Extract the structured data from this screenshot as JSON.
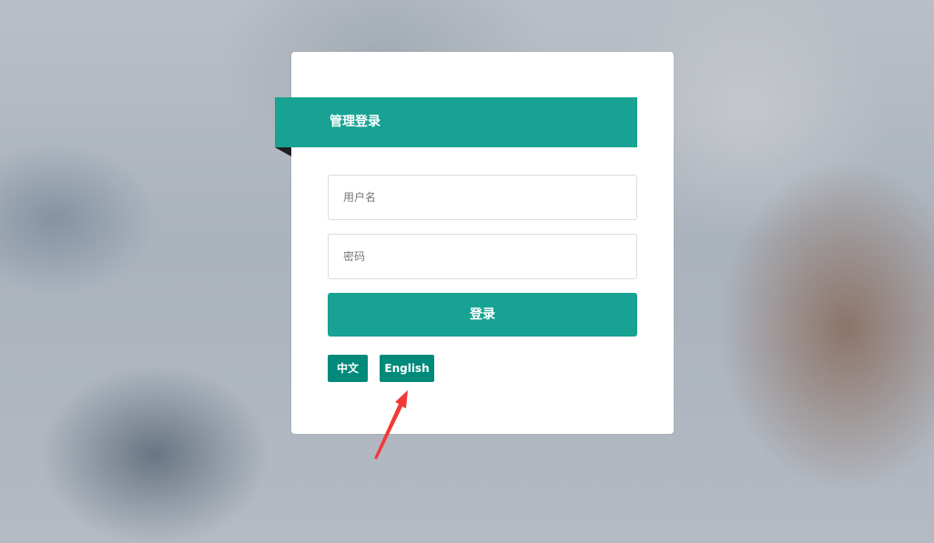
{
  "login_panel": {
    "title": "管理登录",
    "username_placeholder": "用户名",
    "password_placeholder": "密码",
    "login_label": "登录"
  },
  "language": {
    "options": [
      "中文",
      "English"
    ]
  },
  "colors": {
    "accent": "#17a293",
    "lang_button": "#008a7b",
    "annotation_arrow": "#f03a36"
  }
}
